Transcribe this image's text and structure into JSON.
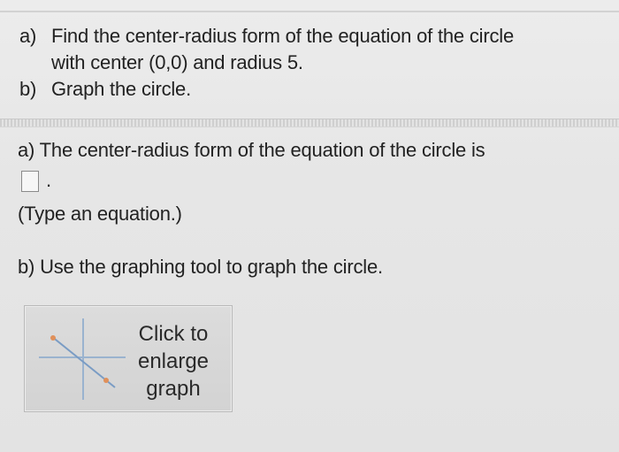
{
  "question": {
    "part_a_letter": "a)",
    "part_a_line1": "Find the center-radius form of the equation of the circle",
    "part_a_line2": "with center (0,0) and radius 5.",
    "part_b_letter": "b)",
    "part_b_text": "Graph the circle."
  },
  "answer": {
    "part_a_text": "a) The center-radius form of the equation of the circle is",
    "period": ".",
    "hint": "(Type an equation.)",
    "part_b_text": "b) Use the graphing tool to graph the circle."
  },
  "graph_button": {
    "line1": "Click to",
    "line2": "enlarge",
    "line3": "graph",
    "icon": "graph-thumbnail-icon"
  },
  "colors": {
    "background": "#e6e6e6",
    "text": "#222222",
    "axis": "#7aa0c8",
    "line": "#e0905a"
  }
}
